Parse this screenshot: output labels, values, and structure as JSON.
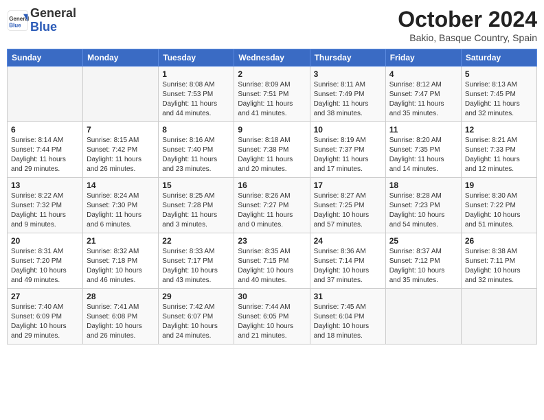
{
  "header": {
    "logo_general": "General",
    "logo_blue": "Blue",
    "month_title": "October 2024",
    "location": "Bakio, Basque Country, Spain"
  },
  "weekdays": [
    "Sunday",
    "Monday",
    "Tuesday",
    "Wednesday",
    "Thursday",
    "Friday",
    "Saturday"
  ],
  "weeks": [
    [
      {
        "day": "",
        "info": ""
      },
      {
        "day": "",
        "info": ""
      },
      {
        "day": "1",
        "info": "Sunrise: 8:08 AM\nSunset: 7:53 PM\nDaylight: 11 hours and 44 minutes."
      },
      {
        "day": "2",
        "info": "Sunrise: 8:09 AM\nSunset: 7:51 PM\nDaylight: 11 hours and 41 minutes."
      },
      {
        "day": "3",
        "info": "Sunrise: 8:11 AM\nSunset: 7:49 PM\nDaylight: 11 hours and 38 minutes."
      },
      {
        "day": "4",
        "info": "Sunrise: 8:12 AM\nSunset: 7:47 PM\nDaylight: 11 hours and 35 minutes."
      },
      {
        "day": "5",
        "info": "Sunrise: 8:13 AM\nSunset: 7:45 PM\nDaylight: 11 hours and 32 minutes."
      }
    ],
    [
      {
        "day": "6",
        "info": "Sunrise: 8:14 AM\nSunset: 7:44 PM\nDaylight: 11 hours and 29 minutes."
      },
      {
        "day": "7",
        "info": "Sunrise: 8:15 AM\nSunset: 7:42 PM\nDaylight: 11 hours and 26 minutes."
      },
      {
        "day": "8",
        "info": "Sunrise: 8:16 AM\nSunset: 7:40 PM\nDaylight: 11 hours and 23 minutes."
      },
      {
        "day": "9",
        "info": "Sunrise: 8:18 AM\nSunset: 7:38 PM\nDaylight: 11 hours and 20 minutes."
      },
      {
        "day": "10",
        "info": "Sunrise: 8:19 AM\nSunset: 7:37 PM\nDaylight: 11 hours and 17 minutes."
      },
      {
        "day": "11",
        "info": "Sunrise: 8:20 AM\nSunset: 7:35 PM\nDaylight: 11 hours and 14 minutes."
      },
      {
        "day": "12",
        "info": "Sunrise: 8:21 AM\nSunset: 7:33 PM\nDaylight: 11 hours and 12 minutes."
      }
    ],
    [
      {
        "day": "13",
        "info": "Sunrise: 8:22 AM\nSunset: 7:32 PM\nDaylight: 11 hours and 9 minutes."
      },
      {
        "day": "14",
        "info": "Sunrise: 8:24 AM\nSunset: 7:30 PM\nDaylight: 11 hours and 6 minutes."
      },
      {
        "day": "15",
        "info": "Sunrise: 8:25 AM\nSunset: 7:28 PM\nDaylight: 11 hours and 3 minutes."
      },
      {
        "day": "16",
        "info": "Sunrise: 8:26 AM\nSunset: 7:27 PM\nDaylight: 11 hours and 0 minutes."
      },
      {
        "day": "17",
        "info": "Sunrise: 8:27 AM\nSunset: 7:25 PM\nDaylight: 10 hours and 57 minutes."
      },
      {
        "day": "18",
        "info": "Sunrise: 8:28 AM\nSunset: 7:23 PM\nDaylight: 10 hours and 54 minutes."
      },
      {
        "day": "19",
        "info": "Sunrise: 8:30 AM\nSunset: 7:22 PM\nDaylight: 10 hours and 51 minutes."
      }
    ],
    [
      {
        "day": "20",
        "info": "Sunrise: 8:31 AM\nSunset: 7:20 PM\nDaylight: 10 hours and 49 minutes."
      },
      {
        "day": "21",
        "info": "Sunrise: 8:32 AM\nSunset: 7:18 PM\nDaylight: 10 hours and 46 minutes."
      },
      {
        "day": "22",
        "info": "Sunrise: 8:33 AM\nSunset: 7:17 PM\nDaylight: 10 hours and 43 minutes."
      },
      {
        "day": "23",
        "info": "Sunrise: 8:35 AM\nSunset: 7:15 PM\nDaylight: 10 hours and 40 minutes."
      },
      {
        "day": "24",
        "info": "Sunrise: 8:36 AM\nSunset: 7:14 PM\nDaylight: 10 hours and 37 minutes."
      },
      {
        "day": "25",
        "info": "Sunrise: 8:37 AM\nSunset: 7:12 PM\nDaylight: 10 hours and 35 minutes."
      },
      {
        "day": "26",
        "info": "Sunrise: 8:38 AM\nSunset: 7:11 PM\nDaylight: 10 hours and 32 minutes."
      }
    ],
    [
      {
        "day": "27",
        "info": "Sunrise: 7:40 AM\nSunset: 6:09 PM\nDaylight: 10 hours and 29 minutes."
      },
      {
        "day": "28",
        "info": "Sunrise: 7:41 AM\nSunset: 6:08 PM\nDaylight: 10 hours and 26 minutes."
      },
      {
        "day": "29",
        "info": "Sunrise: 7:42 AM\nSunset: 6:07 PM\nDaylight: 10 hours and 24 minutes."
      },
      {
        "day": "30",
        "info": "Sunrise: 7:44 AM\nSunset: 6:05 PM\nDaylight: 10 hours and 21 minutes."
      },
      {
        "day": "31",
        "info": "Sunrise: 7:45 AM\nSunset: 6:04 PM\nDaylight: 10 hours and 18 minutes."
      },
      {
        "day": "",
        "info": ""
      },
      {
        "day": "",
        "info": ""
      }
    ]
  ]
}
